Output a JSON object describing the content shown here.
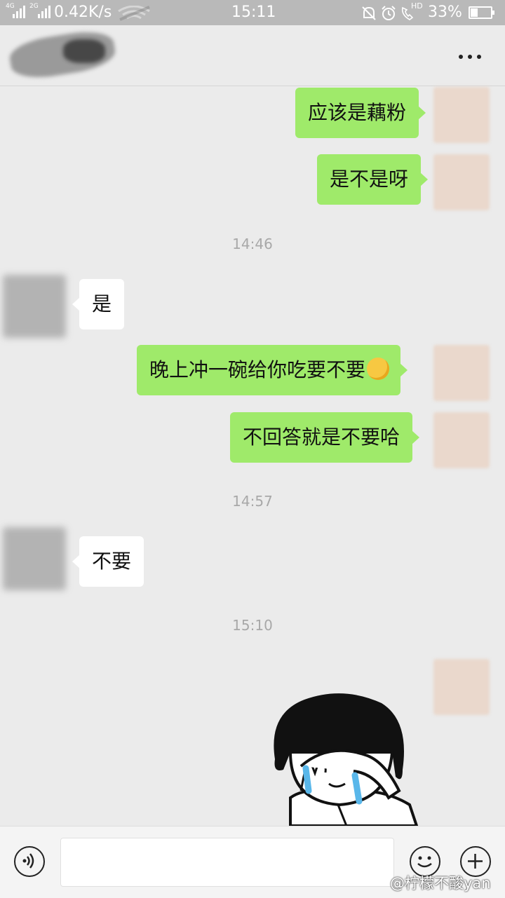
{
  "status_bar": {
    "net1": "4G",
    "net2": "2G",
    "speed": "0.42K/s",
    "time": "15:11",
    "volte": "HD",
    "battery": "33%",
    "battery_level": 0.33
  },
  "header": {
    "more_icon": "more-horizontal-icon"
  },
  "messages": [
    {
      "type": "out",
      "text": "应该是藕粉"
    },
    {
      "type": "out",
      "text": "是不是呀"
    },
    {
      "type": "time",
      "text": "14:46"
    },
    {
      "type": "in",
      "text": "是"
    },
    {
      "type": "out",
      "text": "晚上冲一碗给你吃要不要",
      "emoji": "blush-emoji"
    },
    {
      "type": "out",
      "text": "不回答就是不要哈"
    },
    {
      "type": "time",
      "text": "14:57"
    },
    {
      "type": "in",
      "text": "不要"
    },
    {
      "type": "time",
      "text": "15:10"
    },
    {
      "type": "sticker",
      "icon": "crying-girl-sticker"
    }
  ],
  "input_bar": {
    "voice_icon": "voice-icon",
    "input_value": "",
    "emoji_icon": "emoji-icon",
    "plus_icon": "plus-icon"
  },
  "watermark": "@柠檬不酸yan"
}
